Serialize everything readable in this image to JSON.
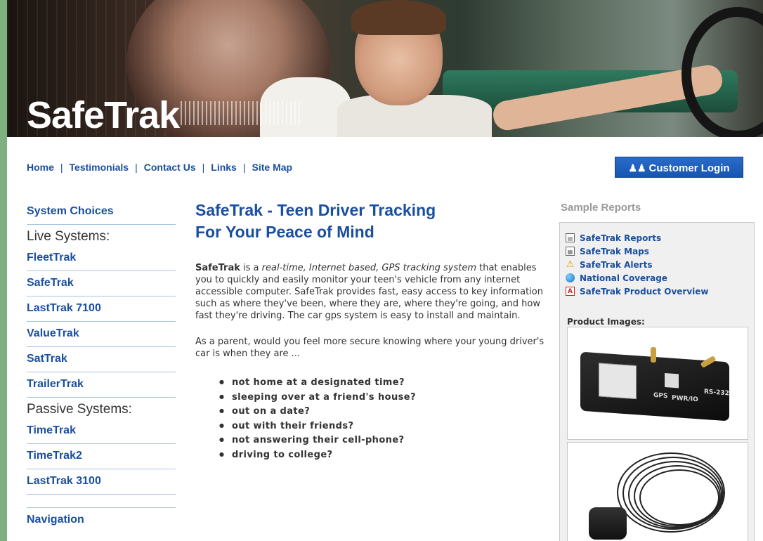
{
  "brand": {
    "logo_text_1": "Safe",
    "logo_text_2": "Trak"
  },
  "top_nav": {
    "items": [
      "Home",
      "Testimonials",
      "Contact Us",
      "Links",
      "Site Map"
    ],
    "separator": "|"
  },
  "login": {
    "label": "Customer Login",
    "icon": "users-icon"
  },
  "left_nav": {
    "system_choices": "System Choices",
    "live_heading": "Live Systems:",
    "live_items": [
      "FleetTrak",
      "SafeTrak",
      "LastTrak 7100",
      "ValueTrak",
      "SatTrak",
      "TrailerTrak"
    ],
    "passive_heading": "Passive Systems:",
    "passive_items": [
      "TimeTrak",
      "TimeTrak2",
      "LastTrak 3100"
    ],
    "navigation": "Navigation"
  },
  "main": {
    "title_line1": "SafeTrak - Teen Driver Tracking",
    "title_line2": "For Your Peace of Mind",
    "intro_brand": "SafeTrak",
    "intro_part1": " is a ",
    "intro_em1": "real-time, Internet based, GPS tracking system",
    "intro_part2": " that enables you to quickly and easily monitor your teen's vehicle from any internet accessible computer. SafeTrak provides fast, easy access to key information such as where they've been, where they are, where they're going, and how fast they're driving. The car gps system is easy to install and maintain.",
    "parent_question": "As a parent, would you feel more secure knowing where your young driver's car is when they are ...",
    "concerns": [
      "not home at a designated time?",
      "sleeping over at a friend's house?",
      "out on a date?",
      "out with their friends?",
      "not answering their cell-phone?",
      "driving to college?"
    ]
  },
  "sidebar": {
    "title": "Sample Reports",
    "reports": [
      {
        "label": "SafeTrak Reports",
        "icon": "document-icon"
      },
      {
        "label": "SafeTrak Maps",
        "icon": "map-document-icon"
      },
      {
        "label": "SafeTrak Alerts",
        "icon": "alert-icon"
      },
      {
        "label": "National Coverage",
        "icon": "globe-icon"
      },
      {
        "label": "SafeTrak Product Overview",
        "icon": "pdf-icon"
      }
    ],
    "product_images_label": "Product Images:",
    "device_labels": {
      "gps": "GPS",
      "power": "PWR/IO",
      "serial": "RS-232"
    }
  },
  "colors": {
    "link": "#1a4fa0",
    "heading_gray": "#9a9a9a",
    "login_bg": "#1755b0",
    "outer_bg": "#7fb07f"
  }
}
